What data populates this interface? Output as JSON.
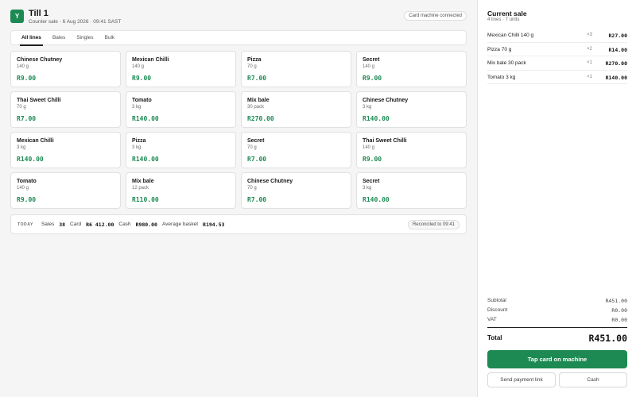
{
  "header": {
    "avatar": "Y",
    "title": "Till 1",
    "subtitle": "Counter sale · 6 Aug 2026 · 09:41 SAST",
    "status": "Card machine connected"
  },
  "tabs": [
    "All lines",
    "Bales",
    "Singles",
    "Bulk"
  ],
  "products": [
    {
      "name": "Chinese Chutney",
      "size": "140 g",
      "price": "R9.00"
    },
    {
      "name": "Mexican Chilli",
      "size": "140 g",
      "price": "R9.00"
    },
    {
      "name": "Pizza",
      "size": "70 g",
      "price": "R7.00"
    },
    {
      "name": "Secret",
      "size": "140 g",
      "price": "R9.00"
    },
    {
      "name": "Thai Sweet Chilli",
      "size": "70 g",
      "price": "R7.00"
    },
    {
      "name": "Tomato",
      "size": "3 kg",
      "price": "R140.00"
    },
    {
      "name": "Mix bale",
      "size": "30 pack",
      "price": "R270.00"
    },
    {
      "name": "Chinese Chutney",
      "size": "3 kg",
      "price": "R140.00"
    },
    {
      "name": "Mexican Chilli",
      "size": "3 kg",
      "price": "R140.00"
    },
    {
      "name": "Pizza",
      "size": "3 kg",
      "price": "R140.00"
    },
    {
      "name": "Secret",
      "size": "70 g",
      "price": "R7.00"
    },
    {
      "name": "Thai Sweet Chilli",
      "size": "140 g",
      "price": "R9.00"
    },
    {
      "name": "Tomato",
      "size": "140 g",
      "price": "R9.00"
    },
    {
      "name": "Mix bale",
      "size": "12 pack",
      "price": "R110.00"
    },
    {
      "name": "Chinese Chutney",
      "size": "70 g",
      "price": "R7.00"
    },
    {
      "name": "Secret",
      "size": "3 kg",
      "price": "R140.00"
    }
  ],
  "summary": {
    "label": "TODAY",
    "sales_label": "Sales",
    "sales": "38",
    "card_label": "Card",
    "card": "R6 412.00",
    "cash_label": "Cash",
    "cash": "R980.00",
    "avg_label": "Average basket",
    "avg": "R194.53",
    "reconciled": "Reconciled to 09:41"
  },
  "sale": {
    "title": "Current sale",
    "subtitle": "4 lines · 7 units",
    "lines": [
      {
        "name": "Mexican Chilli 140 g",
        "qty": "×3",
        "amount": "R27.00"
      },
      {
        "name": "Pizza 70 g",
        "qty": "×2",
        "amount": "R14.00"
      },
      {
        "name": "Mix bale 30 pack",
        "qty": "×1",
        "amount": "R270.00"
      },
      {
        "name": "Tomato 3 kg",
        "qty": "×1",
        "amount": "R140.00"
      }
    ],
    "subtotal_label": "Subtotal",
    "subtotal": "R451.00",
    "discount_label": "Discount",
    "discount": "R0.00",
    "vat_label": "VAT",
    "vat": "R0.00",
    "total_label": "Total",
    "total": "R451.00",
    "pay_card": "Tap card on machine",
    "pay_link": "Send payment link",
    "pay_cash": "Cash"
  },
  "colors": {
    "accent": "#1c8a52"
  }
}
